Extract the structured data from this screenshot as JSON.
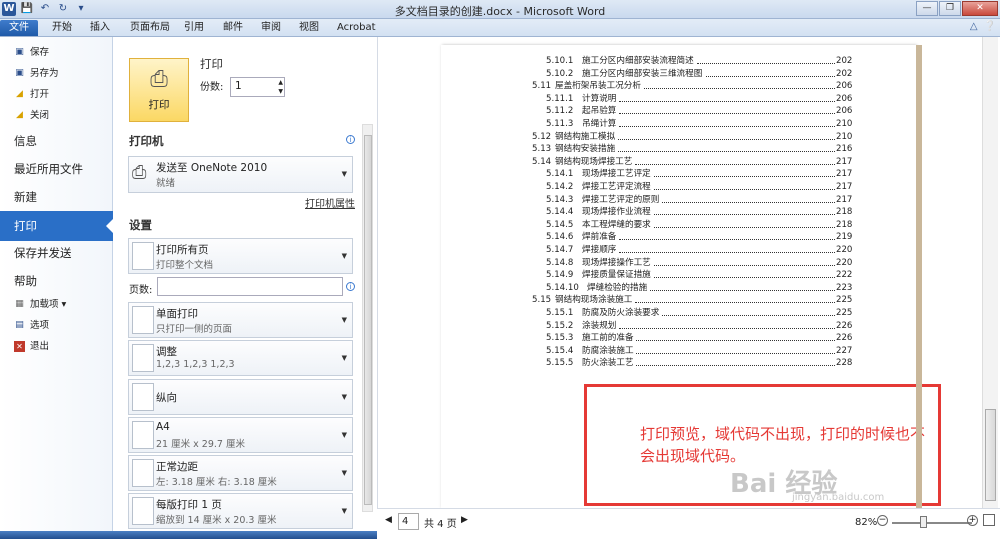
{
  "window": {
    "title": "多文档目录的创建.docx - Microsoft Word"
  },
  "qat": {
    "app_icon": "W",
    "save_icon": "save-icon",
    "undo_icon": "undo-icon"
  },
  "tabs": [
    "文件",
    "开始",
    "插入",
    "页面布局",
    "引用",
    "邮件",
    "审阅",
    "视图",
    "Acrobat"
  ],
  "backstage_nav": {
    "save": "保存",
    "save_as": "另存为",
    "open": "打开",
    "close": "关闭",
    "info": "信息",
    "recent": "最近所用文件",
    "new": "新建",
    "print": "打印",
    "save_send": "保存并发送",
    "help": "帮助",
    "addins": "加载项",
    "options": "选项",
    "exit": "退出"
  },
  "print": {
    "heading": "打印",
    "button_label": "打印",
    "copies_label": "份数:",
    "copies_value": "1",
    "printer_heading": "打印机",
    "printer_name": "发送至 OneNote 2010",
    "printer_status": "就绪",
    "printer_properties": "打印机属性",
    "settings_heading": "设置",
    "pages_label": "页数:",
    "options": [
      {
        "title": "打印所有页",
        "sub": "打印整个文档"
      },
      {
        "title": "单面打印",
        "sub": "只打印一侧的页面"
      },
      {
        "title": "调整",
        "sub": "1,2,3    1,2,3    1,2,3"
      },
      {
        "title": "纵向",
        "sub": ""
      },
      {
        "title": "A4",
        "sub": "21 厘米 x 29.7 厘米"
      },
      {
        "title": "正常边距",
        "sub": "左:  3.18 厘米    右:  3.18 厘米"
      },
      {
        "title": "每版打印 1 页",
        "sub": "缩放到 14 厘米 x 20.3 厘米"
      }
    ]
  },
  "toc": [
    {
      "num": "5.10.1",
      "text": "施工分区内细部安装流程简述",
      "page": "202",
      "level": 3
    },
    {
      "num": "5.10.2",
      "text": "施工分区内细部安装三维流程图",
      "page": "202",
      "level": 3
    },
    {
      "num": "5.11",
      "text": "屋盖桁架吊装工况分析",
      "page": "206",
      "level": 2
    },
    {
      "num": "5.11.1",
      "text": "计算说明",
      "page": "206",
      "level": 3
    },
    {
      "num": "5.11.2",
      "text": "起吊验算",
      "page": "206",
      "level": 3
    },
    {
      "num": "5.11.3",
      "text": "吊绳计算",
      "page": "210",
      "level": 3
    },
    {
      "num": "5.12",
      "text": "钢结构施工模拟",
      "page": "210",
      "level": 2
    },
    {
      "num": "5.13",
      "text": "钢结构安装措施",
      "page": "216",
      "level": 2
    },
    {
      "num": "5.14",
      "text": "钢结构现场焊接工艺",
      "page": "217",
      "level": 2
    },
    {
      "num": "5.14.1",
      "text": "现场焊接工艺评定",
      "page": "217",
      "level": 3
    },
    {
      "num": "5.14.2",
      "text": "焊接工艺评定流程",
      "page": "217",
      "level": 3
    },
    {
      "num": "5.14.3",
      "text": "焊接工艺评定的原则",
      "page": "217",
      "level": 3
    },
    {
      "num": "5.14.4",
      "text": "现场焊接作业流程",
      "page": "218",
      "level": 3
    },
    {
      "num": "5.14.5",
      "text": "本工程焊缝的要求",
      "page": "218",
      "level": 3
    },
    {
      "num": "5.14.6",
      "text": "焊前准备",
      "page": "219",
      "level": 3
    },
    {
      "num": "5.14.7",
      "text": "焊接顺序",
      "page": "220",
      "level": 3
    },
    {
      "num": "5.14.8",
      "text": "现场焊接操作工艺",
      "page": "220",
      "level": 3
    },
    {
      "num": "5.14.9",
      "text": "焊接质量保证措施",
      "page": "222",
      "level": 3
    },
    {
      "num": "5.14.10",
      "text": "焊缝检验的措施",
      "page": "223",
      "level": 3
    },
    {
      "num": "5.15",
      "text": "钢结构现场涂装施工",
      "page": "225",
      "level": 2
    },
    {
      "num": "5.15.1",
      "text": "防腐及防火涂装要求",
      "page": "225",
      "level": 3
    },
    {
      "num": "5.15.2",
      "text": "涂装规划",
      "page": "226",
      "level": 3
    },
    {
      "num": "5.15.3",
      "text": "施工前的准备",
      "page": "226",
      "level": 3
    },
    {
      "num": "5.15.4",
      "text": "防腐涂装施工",
      "page": "227",
      "level": 3
    },
    {
      "num": "5.15.5",
      "text": "防火涂装工艺",
      "page": "228",
      "level": 3
    }
  ],
  "annotation": "打印预览，域代码不出现，打印的时候也不会出现域代码。",
  "status": {
    "current_page": "4",
    "total_pages": "共 4 页",
    "zoom": "82%"
  },
  "watermark": {
    "logo": "Bai 经验",
    "url": "jingyan.baidu.com"
  },
  "colors": {
    "accent": "#2a6fc7",
    "annotation": "#e53935",
    "print_button": "#fbd864"
  }
}
